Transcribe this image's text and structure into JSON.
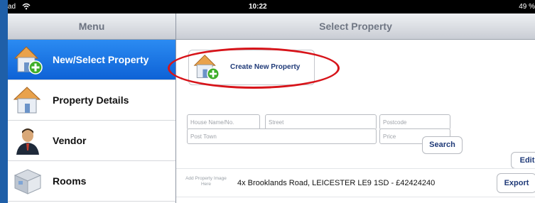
{
  "status_bar": {
    "device": "iPad",
    "time": "10:22",
    "battery": "49 %"
  },
  "sidebar": {
    "title": "Menu",
    "items": [
      {
        "label": "New/Select Property",
        "icon": "house-add-icon",
        "selected": true
      },
      {
        "label": "Property Details",
        "icon": "house-icon",
        "selected": false
      },
      {
        "label": "Vendor",
        "icon": "person-icon",
        "selected": false
      },
      {
        "label": "Rooms",
        "icon": "room-icon",
        "selected": false
      }
    ]
  },
  "main": {
    "title": "Select Property",
    "create_button": "Create New Property",
    "fields": {
      "house_name": "House Name/No.",
      "street": "Street",
      "postcode": "Postcode",
      "post_town": "Post Town",
      "price": "Price"
    },
    "search_button": "Search",
    "edit_button": "Edit",
    "result": {
      "image_placeholder": "Add Property Image Here",
      "text": "4x Brooklands Road, LEICESTER LE9 1SD - £42424240",
      "export_button": "Export"
    }
  },
  "colors": {
    "selected": "#0e62d6",
    "highlight_oval": "#d7141a",
    "button_text": "#1f3a78"
  }
}
